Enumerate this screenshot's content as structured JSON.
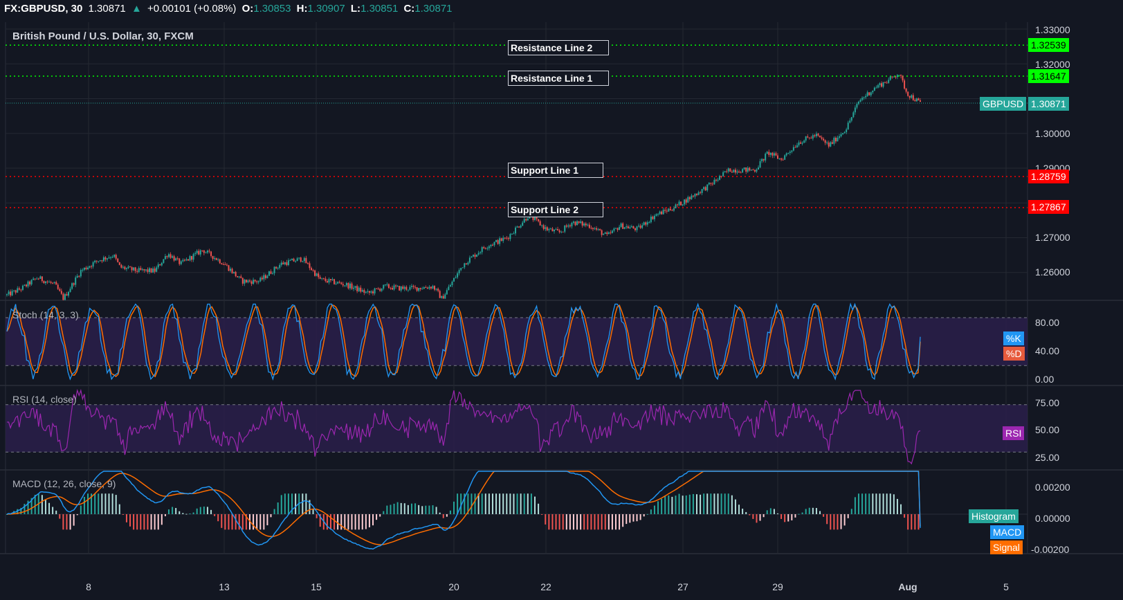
{
  "header": {
    "symbol": "FX:GBPUSD, 30",
    "last": "1.30871",
    "change_arrow": "▲",
    "change": "+0.00101 (+0.08%)",
    "o_label": "O:",
    "o": "1.30853",
    "h_label": "H:",
    "h": "1.30907",
    "l_label": "L:",
    "l": "1.30851",
    "c_label": "C:",
    "c": "1.30871"
  },
  "chart_title": "British Pound / U.S. Dollar, 30, FXCM",
  "colors": {
    "background": "#131722",
    "up_candle": "#26a69a",
    "down_candle": "#ef5350",
    "resistance": "#00ff00",
    "support": "#ff0000",
    "stoch_k": "#2196f3",
    "stoch_d": "#ff6d00",
    "rsi": "#9c27b0",
    "macd": "#2196f3",
    "signal": "#ff6d00"
  },
  "annotations": {
    "resistance2": "Resistance Line 2",
    "resistance1": "Resistance Line 1",
    "support1": "Support Line 1",
    "support2": "Support Line 2"
  },
  "price_tags": {
    "resistance2": "1.32539",
    "resistance1": "1.31647",
    "current_name": "GBPUSD",
    "current": "1.30871",
    "support1": "1.28759",
    "support2": "1.27867"
  },
  "price_axis": [
    "1.33000",
    "1.32000",
    "1.30000",
    "1.29000",
    "1.27000",
    "1.26000"
  ],
  "stoch": {
    "label": "Stoch (14, 3, 3)",
    "axis": [
      "80.00",
      "40.00",
      "0.00"
    ],
    "k_tag": "%K",
    "d_tag": "%D"
  },
  "rsi": {
    "label": "RSI (14, close)",
    "axis": [
      "75.00",
      "50.00",
      "25.00"
    ],
    "tag": "RSI"
  },
  "macd": {
    "label": "MACD (12, 26, close, 9)",
    "axis": [
      "0.00200",
      "0.00000",
      "-0.00200"
    ],
    "hist_tag": "Histogram",
    "macd_tag": "MACD",
    "signal_tag": "Signal"
  },
  "x_axis": [
    "8",
    "13",
    "15",
    "20",
    "22",
    "27",
    "29",
    "Aug",
    "5"
  ],
  "chart_data": [
    {
      "type": "candlestick",
      "title": "British Pound / U.S. Dollar, 30, FXCM",
      "ylim": [
        1.252,
        1.332
      ],
      "x_labels": [
        "8",
        "13",
        "15",
        "20",
        "22",
        "27",
        "29",
        "Aug",
        "5"
      ],
      "close_path": [
        [
          0,
          1.2535
        ],
        [
          0.035,
          1.2555
        ],
        [
          0.07,
          1.2585
        ],
        [
          0.11,
          1.2565
        ],
        [
          0.13,
          1.2525
        ],
        [
          0.17,
          1.2605
        ],
        [
          0.21,
          1.2635
        ],
        [
          0.245,
          1.265
        ],
        [
          0.26,
          1.2615
        ],
        [
          0.3,
          1.2605
        ],
        [
          0.34,
          1.2605
        ],
        [
          0.37,
          1.2655
        ],
        [
          0.4,
          1.2625
        ],
        [
          0.45,
          1.2665
        ],
        [
          0.5,
          1.2625
        ],
        [
          0.54,
          1.2575
        ],
        [
          0.58,
          1.2575
        ],
        [
          0.63,
          1.2625
        ],
        [
          0.68,
          1.264
        ],
        [
          0.72,
          1.258
        ],
        [
          0.78,
          1.2565
        ],
        [
          0.83,
          1.254
        ],
        [
          0.87,
          1.256
        ],
        [
          0.9,
          1.2555
        ],
        [
          0.94,
          1.2555
        ],
        [
          0.98,
          1.256
        ],
        [
          1.0,
          1.2525
        ],
        [
          1.05,
          1.2625
        ],
        [
          1.1,
          1.2675
        ],
        [
          1.15,
          1.27
        ],
        [
          1.2,
          1.2765
        ],
        [
          1.24,
          1.2725
        ],
        [
          1.27,
          1.2715
        ],
        [
          1.3,
          1.2745
        ],
        [
          1.34,
          1.2735
        ],
        [
          1.38,
          1.2705
        ],
        [
          1.41,
          1.2735
        ],
        [
          1.45,
          1.2725
        ],
        [
          1.49,
          1.2765
        ],
        [
          1.53,
          1.2785
        ],
        [
          1.57,
          1.2815
        ],
        [
          1.62,
          1.2855
        ],
        [
          1.66,
          1.2895
        ],
        [
          1.69,
          1.2895
        ],
        [
          1.72,
          1.2895
        ],
        [
          1.75,
          1.2945
        ],
        [
          1.78,
          1.2925
        ],
        [
          1.82,
          1.2975
        ],
        [
          1.86,
          1.2995
        ],
        [
          1.89,
          1.2965
        ],
        [
          1.93,
          1.3015
        ],
        [
          1.96,
          1.3095
        ],
        [
          2.0,
          1.3135
        ],
        [
          2.03,
          1.3155
        ],
        [
          2.05,
          1.3175
        ],
        [
          2.07,
          1.3115
        ],
        [
          2.1,
          1.3087
        ]
      ],
      "resistance_lines": [
        1.32539,
        1.31647
      ],
      "support_lines": [
        1.28759,
        1.27867
      ],
      "last": 1.30871
    },
    {
      "type": "line",
      "title": "Stoch (14, 3, 3)",
      "ylim": [
        -5,
        100
      ],
      "bands": [
        80,
        20
      ],
      "series": [
        {
          "name": "%K",
          "last": 56
        },
        {
          "name": "%D",
          "last": 50
        }
      ]
    },
    {
      "type": "line",
      "title": "RSI (14, close)",
      "ylim": [
        15,
        85
      ],
      "bands": [
        70,
        30
      ],
      "series": [
        {
          "name": "RSI",
          "last": 48
        }
      ]
    },
    {
      "type": "bar",
      "title": "MACD (12, 26, close, 9)",
      "ylim": [
        -0.0023,
        0.0025
      ],
      "series": [
        {
          "name": "Histogram"
        },
        {
          "name": "MACD",
          "last": -0.0008
        },
        {
          "name": "Signal",
          "last": -0.0007
        }
      ]
    }
  ]
}
